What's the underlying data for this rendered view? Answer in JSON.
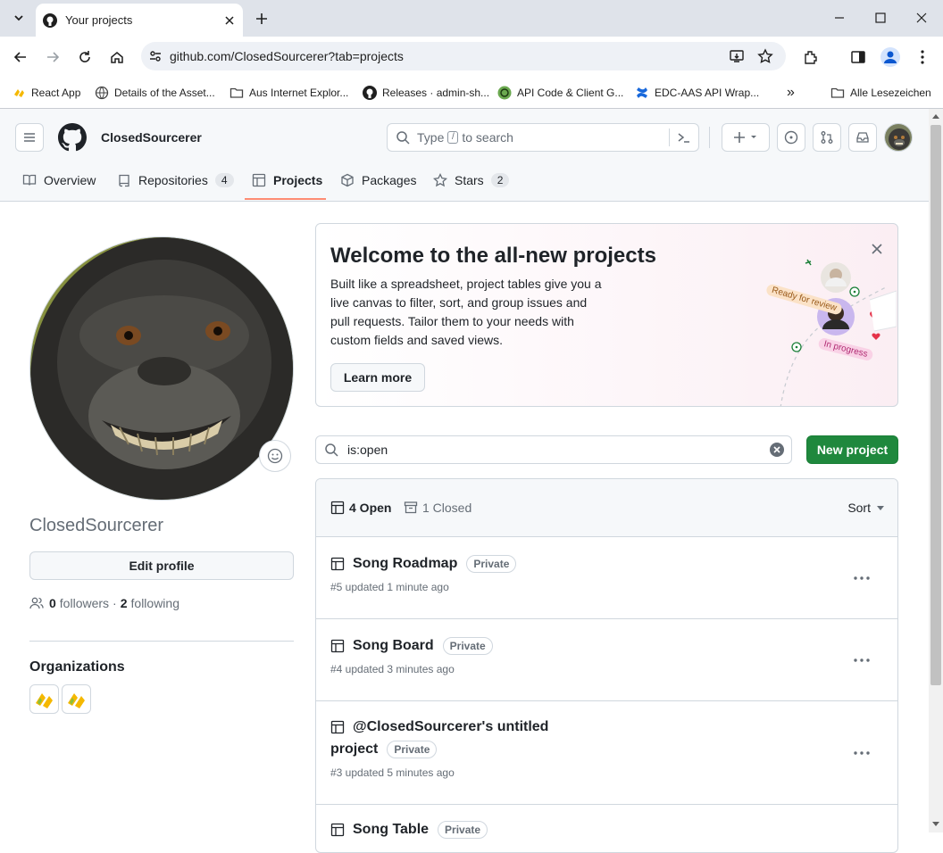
{
  "browser": {
    "tab_title": "Your projects",
    "url": "github.com/ClosedSourcerer?tab=projects",
    "bookmarks": [
      {
        "label": "React App"
      },
      {
        "label": "Details of the Asset..."
      },
      {
        "label": "Aus Internet Explor..."
      },
      {
        "label": "Releases · admin-sh..."
      },
      {
        "label": "API Code & Client G..."
      },
      {
        "label": "EDC-AAS API Wrap..."
      }
    ],
    "all_bookmarks": "Alle Lesezeichen",
    "more_bookmarks": "»"
  },
  "header": {
    "username": "ClosedSourcerer",
    "search": {
      "prefix": "Type",
      "key": "/",
      "suffix": "to search"
    },
    "nav": [
      {
        "label": "Overview"
      },
      {
        "label": "Repositories",
        "count": "4"
      },
      {
        "label": "Projects"
      },
      {
        "label": "Packages"
      },
      {
        "label": "Stars",
        "count": "2"
      }
    ]
  },
  "profile": {
    "name": "ClosedSourcerer",
    "edit_label": "Edit profile",
    "followers_count": "0",
    "followers_label": "followers",
    "separator": "·",
    "following_count": "2",
    "following_label": "following",
    "orgs_title": "Organizations"
  },
  "banner": {
    "title": "Welcome to the all-new projects",
    "text": "Built like a spreadsheet, project tables give you a live canvas to filter, sort, and group issues and pull requests. Tailor them to your needs with custom fields and saved views.",
    "button": "Learn more",
    "tag_review": "Ready for review",
    "tag_progress": "In progress"
  },
  "filter": {
    "value": "is:open",
    "new_project": "New project"
  },
  "projects": {
    "open_label": "4 Open",
    "closed_label": "1 Closed",
    "sort_label": "Sort",
    "items": [
      {
        "title": "Song Roadmap",
        "badge": "Private",
        "meta": "#5 updated 1 minute ago"
      },
      {
        "title": "Song Board",
        "badge": "Private",
        "meta": "#4 updated 3 minutes ago"
      },
      {
        "title_line1": "@ClosedSourcerer's untitled",
        "title_line2": "project",
        "badge": "Private",
        "meta": "#3 updated 5 minutes ago"
      },
      {
        "title": "Song Table",
        "badge": "Private"
      }
    ]
  },
  "colors": {
    "primary_button": "#1f883d",
    "tab_underline": "#fd8c73",
    "text": "#1f2328",
    "muted": "#656d76"
  }
}
